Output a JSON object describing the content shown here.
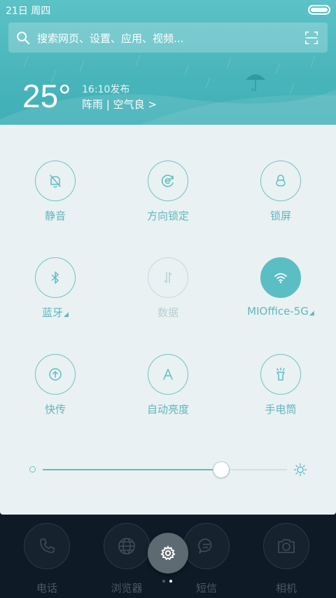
{
  "status_bar": {
    "date": "21日  周四"
  },
  "search": {
    "placeholder": "搜索网页、设置、应用、视频..."
  },
  "weather": {
    "temperature": "25°",
    "update_time": "16:10发布",
    "condition": "阵雨 | 空气良 >"
  },
  "quick_settings": {
    "tiles": [
      {
        "label": "静音",
        "icon": "bell-off-icon",
        "state": "off"
      },
      {
        "label": "方向锁定",
        "icon": "rotation-lock-icon",
        "state": "off"
      },
      {
        "label": "锁屏",
        "icon": "lock-icon",
        "state": "off"
      },
      {
        "label": "蓝牙",
        "icon": "bluetooth-icon",
        "state": "off",
        "has_more": true
      },
      {
        "label": "数据",
        "icon": "mobile-data-icon",
        "state": "disabled"
      },
      {
        "label": "MIOffice-5G",
        "icon": "wifi-icon",
        "state": "on",
        "has_more": true
      },
      {
        "label": "快传",
        "icon": "quick-transfer-icon",
        "state": "off"
      },
      {
        "label": "自动亮度",
        "icon": "auto-brightness-icon",
        "state": "off"
      },
      {
        "label": "手电筒",
        "icon": "flashlight-icon",
        "state": "off"
      }
    ],
    "more_marker": "◢",
    "brightness_level": 0.73
  },
  "dock": {
    "apps": [
      {
        "name": "电话",
        "icon": "phone-icon"
      },
      {
        "name": "浏览器",
        "icon": "browser-globe-icon"
      },
      {
        "name": "短信",
        "icon": "message-icon"
      },
      {
        "name": "相机",
        "icon": "camera-icon"
      }
    ],
    "settings_icon": "gear-icon"
  },
  "colors": {
    "accent": "#5bbec3",
    "panel_bg": "#eaf1f3",
    "header_bg": "#4ab6bc",
    "disabled": "#b6cfd1"
  }
}
